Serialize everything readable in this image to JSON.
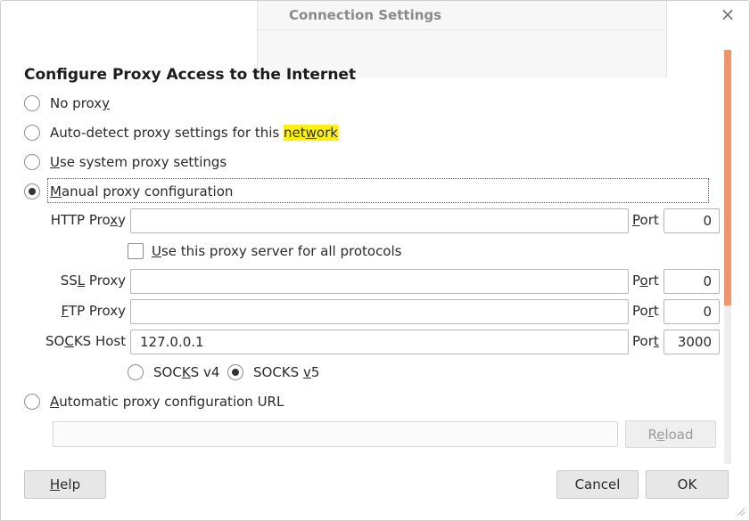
{
  "dialog": {
    "title": "Connection Settings",
    "close_glyph": "×",
    "heading": "Configure Proxy Access to the Internet"
  },
  "proxy_modes": {
    "no_proxy": {
      "pre": "No prox",
      "ul": "y",
      "post": ""
    },
    "auto_detect": {
      "pre": "Auto-detect proxy settings for this ",
      "hl_pre": "net",
      "ul": "w",
      "hl_post": "ork"
    },
    "system": {
      "pre": "",
      "ul": "U",
      "post": "se system proxy settings"
    },
    "manual": {
      "pre": "",
      "ul": "M",
      "post": "anual proxy configuration"
    },
    "auto_url": {
      "pre": "",
      "ul": "A",
      "post": "utomatic proxy configuration URL"
    },
    "selected": "manual"
  },
  "http": {
    "label_pre": "HTTP Pro",
    "label_ul": "x",
    "label_post": "y",
    "value": "",
    "port_label_pre": "",
    "port_label_ul": "P",
    "port_label_post": "ort",
    "port": "0"
  },
  "share": {
    "label_pre": "",
    "label_ul": "U",
    "label_post": "se this proxy server for all protocols",
    "checked": false
  },
  "ssl": {
    "label_pre": "SS",
    "label_ul": "L",
    "label_post": " Proxy",
    "value": "",
    "port_label_pre": "P",
    "port_label_ul": "o",
    "port_label_post": "rt",
    "port": "0"
  },
  "ftp": {
    "label_pre": "",
    "label_ul": "F",
    "label_post": "TP Proxy",
    "value": "",
    "port_label_pre": "Po",
    "port_label_ul": "r",
    "port_label_post": "t",
    "port": "0"
  },
  "socks": {
    "label_pre": "SO",
    "label_ul": "C",
    "label_post": "KS Host",
    "value": "127.0.0.1",
    "port_label_pre": "Por",
    "port_label_ul": "t",
    "port_label_post": "",
    "port": "3000",
    "v4": {
      "pre": "SOC",
      "ul": "K",
      "post": "S v4"
    },
    "v5": {
      "pre": "SOCKS ",
      "ul": "v",
      "post": "5"
    },
    "version_selected": "v5"
  },
  "auto_url_field": {
    "value": ""
  },
  "buttons": {
    "reload": {
      "pre": "R",
      "ul": "e",
      "post": "load"
    },
    "help": {
      "pre": "",
      "ul": "H",
      "post": "elp"
    },
    "cancel": "Cancel",
    "ok": "OK"
  },
  "colors": {
    "scroll_thumb": "#f0956b",
    "highlight": "#fff200"
  }
}
